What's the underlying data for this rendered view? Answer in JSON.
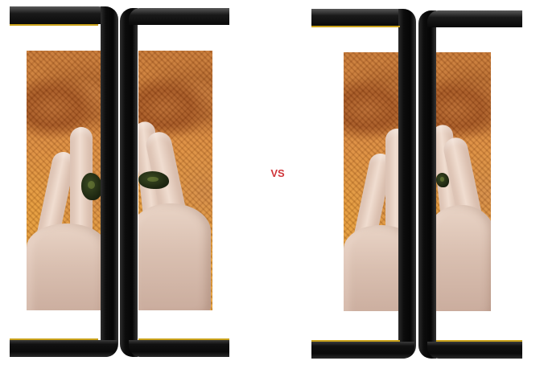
{
  "vs_label": "VS",
  "colors": {
    "vs_text": "#d0353a",
    "bezel": "#0a0a0a",
    "accent": "#c9a11a",
    "background": "#ffffff"
  }
}
